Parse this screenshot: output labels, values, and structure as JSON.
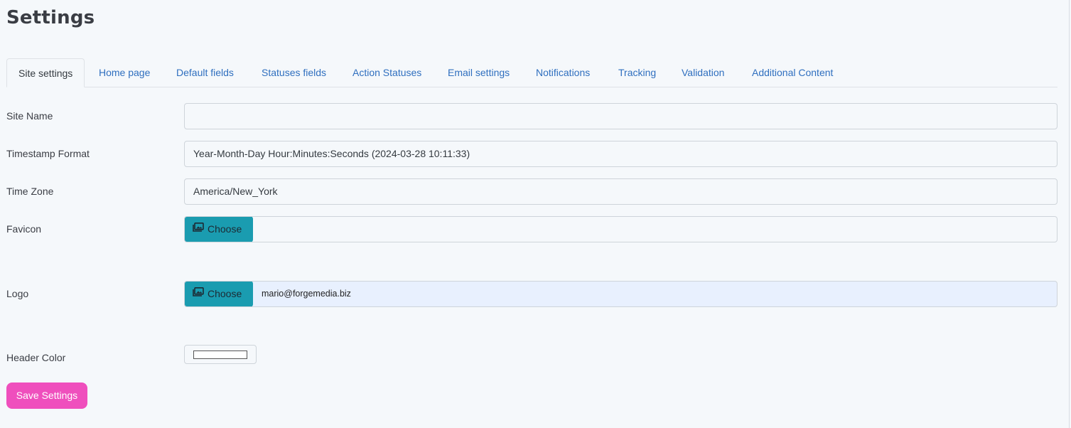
{
  "page": {
    "title": "Settings"
  },
  "tabs": [
    {
      "label": "Site settings",
      "active": true
    },
    {
      "label": "Home page",
      "active": false
    },
    {
      "label": "Default fields",
      "active": false
    },
    {
      "label": "Statuses fields",
      "active": false
    },
    {
      "label": "Action Statuses",
      "active": false
    },
    {
      "label": "Email settings",
      "active": false
    },
    {
      "label": "Notifications",
      "active": false
    },
    {
      "label": "Tracking",
      "active": false
    },
    {
      "label": "Validation",
      "active": false
    },
    {
      "label": "Additional Content",
      "active": false
    }
  ],
  "form": {
    "site_name": {
      "label": "Site Name",
      "value": ""
    },
    "timestamp_format": {
      "label": "Timestamp Format",
      "value": "Year-Month-Day Hour:Minutes:Seconds (2024-03-28 10:11:33)"
    },
    "time_zone": {
      "label": "Time Zone",
      "value": "America/New_York"
    },
    "favicon": {
      "label": "Favicon",
      "button_label": "Choose",
      "value": "",
      "icon": "images-icon"
    },
    "logo": {
      "label": "Logo",
      "button_label": "Choose",
      "value": "mario@forgemedia.biz",
      "icon": "images-icon"
    },
    "header_color": {
      "label": "Header Color",
      "value": "#ffffff"
    }
  },
  "actions": {
    "save_label": "Save Settings"
  },
  "colors": {
    "background": "#f5f8fb",
    "link": "#2f6fbf",
    "choose_button": "#1a9cb0",
    "save_button": "#ef4fbd",
    "autofill_background": "#e8f0fe"
  }
}
